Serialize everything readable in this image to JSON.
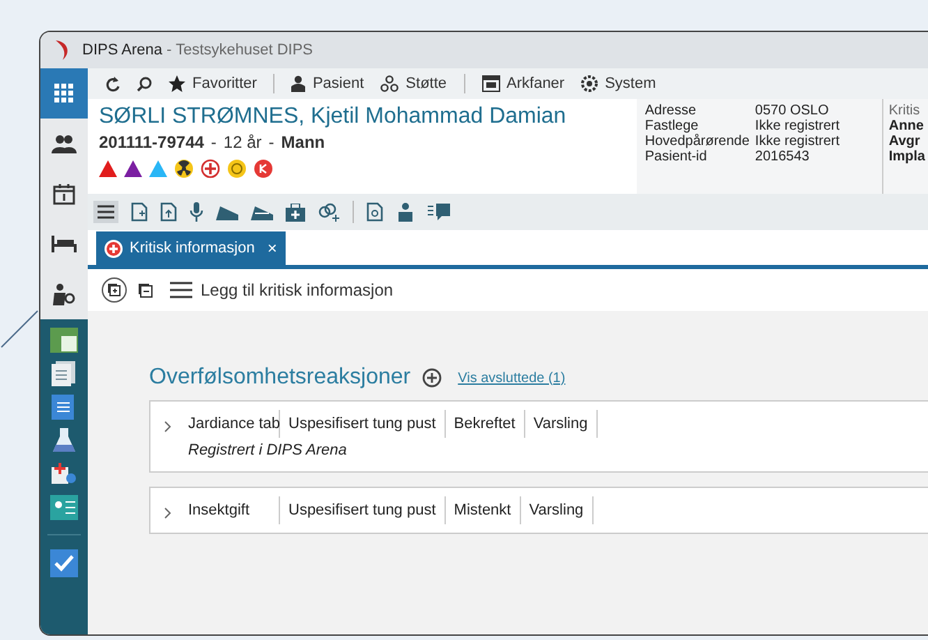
{
  "window": {
    "app": "DIPS Arena",
    "separator": "-",
    "hospital": "Testsykehuset DIPS"
  },
  "menus": [
    {
      "label": "Favoritter"
    },
    {
      "label": "Pasient"
    },
    {
      "label": "Støtte"
    },
    {
      "label": "Arkfaner"
    },
    {
      "label": "System"
    }
  ],
  "patient": {
    "name": "SØRLI STRØMNES, Kjetil Mohammad Damian",
    "id": "201111-79744",
    "sep1": "-",
    "age": "12 år",
    "sep2": "-",
    "sex": "Mann"
  },
  "info": [
    {
      "label": "Adresse",
      "value": "0570 OSLO"
    },
    {
      "label": "Fastlege",
      "value": "Ikke registrert"
    },
    {
      "label": "Hovedpårørende",
      "value": "Ikke registrert"
    },
    {
      "label": "Pasient-id",
      "value": "2016543"
    }
  ],
  "critical_column": [
    {
      "text": "Kritis"
    },
    {
      "text": "Anne"
    },
    {
      "text": "Avgr"
    },
    {
      "text": "Impla"
    }
  ],
  "tabs": [
    {
      "label": "Kritisk informasjon",
      "close": "×",
      "selected": true
    }
  ],
  "action": "Legg til kritisk informasjon",
  "section": {
    "title": "Overfølsomhetsreaksjoner",
    "link": "Vis avsluttede (1)"
  },
  "reactions": [
    {
      "cells": [
        "Jardiance tab",
        "Uspesifisert tung pust",
        "Bekreftet",
        "Varsling"
      ],
      "note": "Registrert i DIPS Arena"
    },
    {
      "cells": [
        "Insektgift",
        "Uspesifisert tung pust",
        "Mistenkt",
        "Varsling"
      ]
    }
  ]
}
